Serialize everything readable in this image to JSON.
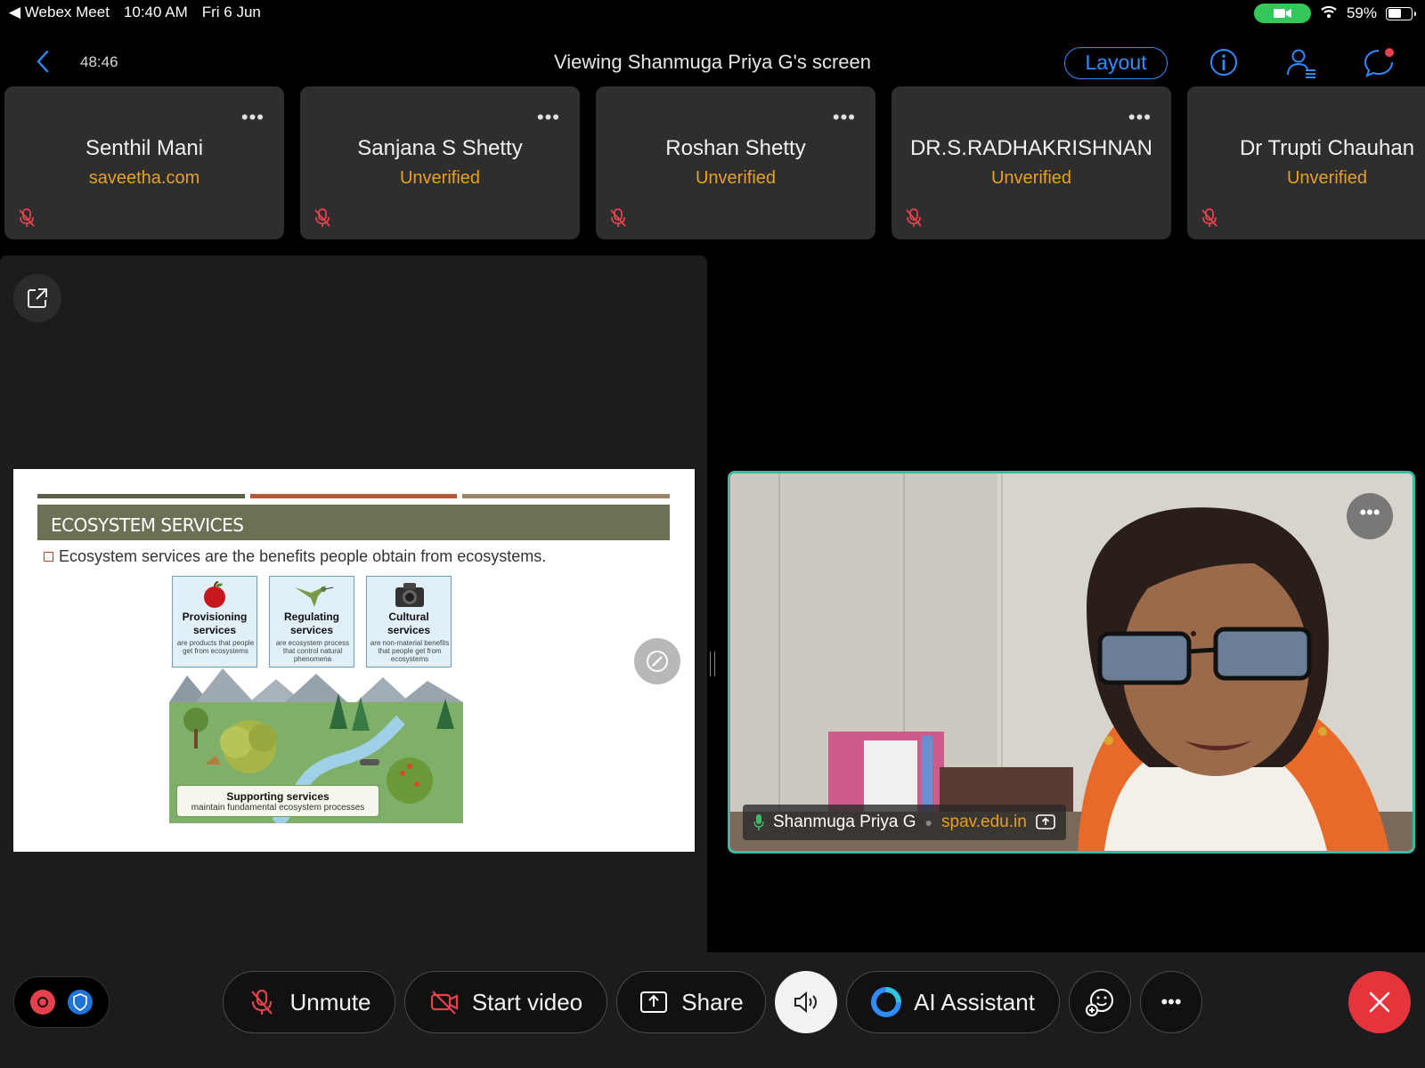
{
  "status_bar": {
    "back_app": "◀ Webex Meet",
    "time": "10:40 AM",
    "date": "Fri 6 Jun",
    "battery": "59%",
    "battery_level": 0.59
  },
  "header": {
    "timer": "48:46",
    "title": "Viewing Shanmuga Priya G's screen",
    "layout_label": "Layout"
  },
  "participants": [
    {
      "name": "Senthil Mani",
      "sub": "saveetha.com"
    },
    {
      "name": "Sanjana S Shetty",
      "sub": "Unverified"
    },
    {
      "name": "Roshan Shetty",
      "sub": "Unverified"
    },
    {
      "name": "DR.S.RADHAKRISHNAN",
      "sub": "Unverified"
    },
    {
      "name": "Dr Trupti Chauhan",
      "sub": "Unverified"
    }
  ],
  "slide": {
    "title": "ECOSYSTEM SERVICES",
    "bullet": "Ecosystem services are the benefits people obtain from ecosystems.",
    "services": [
      {
        "title": "Provisioning services",
        "desc": "are products that people get from ecosystems"
      },
      {
        "title": "Regulating services",
        "desc": "are ecosystem process that control natural phenomena"
      },
      {
        "title": "Cultural services",
        "desc": "are non-material benefits that people get from ecosystems"
      }
    ],
    "supporting": {
      "title": "Supporting services",
      "desc": "maintain fundamental ecosystem processes"
    },
    "bar_colors": [
      "#5a6048",
      "#b8573a",
      "#9c8466"
    ]
  },
  "speaker": {
    "name": "Shanmuga Priya G",
    "org": "spav.edu.in"
  },
  "toolbar": {
    "unmute": "Unmute",
    "start_video": "Start video",
    "share": "Share",
    "ai_assistant": "AI Assistant"
  },
  "colors": {
    "accent": "#2f8cff",
    "muted_red": "#e3424d",
    "org_orange": "#e8a020",
    "active_speaker_border": "#3fb8a0",
    "end_call": "#e5343b"
  }
}
